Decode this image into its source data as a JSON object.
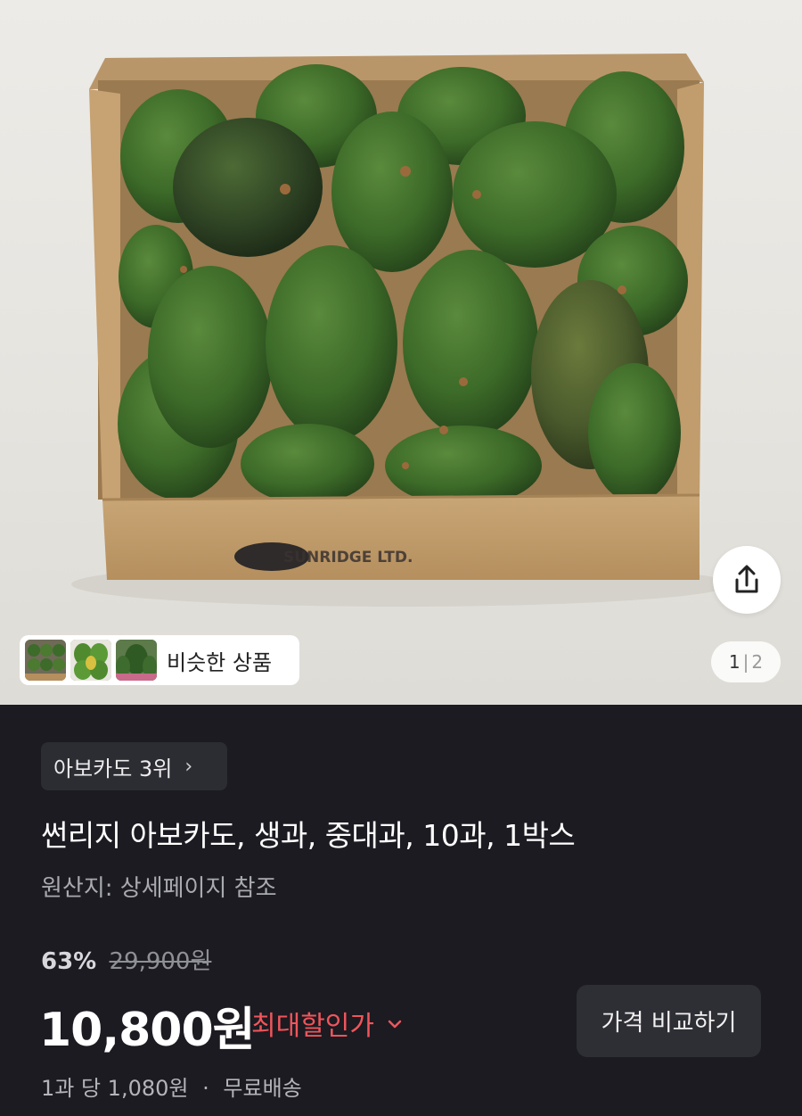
{
  "hero": {
    "box_brand_text": "SUNRIDGE LTD.",
    "similar_label": "비슷한 상품",
    "page_current": "1",
    "page_separator": "|",
    "page_total": "2",
    "share_icon": "share-icon"
  },
  "product": {
    "rank_label": "아보카도 3위",
    "rank_chevron": "›",
    "title": "썬리지 아보카도, 생과, 중대과, 10과, 1박스",
    "origin": "원산지: 상세페이지 참조",
    "discount_percent": "63%",
    "original_price": "29,900원",
    "price": "10,800원",
    "best_price_label": "최대할인가",
    "best_price_chevron": "⌄",
    "compare_button": "가격 비교하기",
    "unit_price": "1과 당 1,080원",
    "separator": "·",
    "shipping": "무료배송"
  },
  "colors": {
    "background": "#1b1b21",
    "accent_red": "#f0555b",
    "chip_bg": "#2c2c33"
  }
}
